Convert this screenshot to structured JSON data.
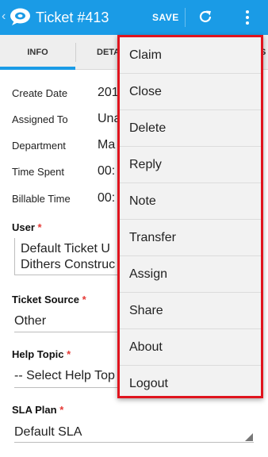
{
  "appbar": {
    "title": "Ticket #413",
    "save_label": "SAVE",
    "back_glyph": "‹",
    "colors": {
      "primary": "#1a9be6"
    }
  },
  "tabs": [
    {
      "label": "INFO",
      "selected": true
    },
    {
      "label": "DETA"
    },
    {
      "label": "S"
    }
  ],
  "info_rows": [
    {
      "label": "Create Date",
      "value": "201"
    },
    {
      "label": "Assigned To",
      "value": "Una"
    },
    {
      "label": "Department",
      "value": "Ma"
    },
    {
      "label": "Time Spent",
      "value": "00:"
    },
    {
      "label": "Billable Time",
      "value": "00:"
    }
  ],
  "user": {
    "label": "User",
    "required_marker": "*",
    "line1": "Default Ticket U",
    "line2": "Dithers Construc"
  },
  "ticket_source": {
    "label": "Ticket Source",
    "required_marker": "*",
    "value": "Other"
  },
  "help_topic": {
    "label": "Help Topic",
    "required_marker": "*",
    "value": "-- Select Help Top"
  },
  "sla_plan": {
    "label": "SLA Plan",
    "required_marker": "*",
    "value": "Default SLA"
  },
  "menu": {
    "border_color": "#e0141e",
    "items": [
      "Claim",
      "Close",
      "Delete",
      "Reply",
      "Note",
      "Transfer",
      "Assign",
      "Share",
      "About",
      "Logout"
    ]
  }
}
